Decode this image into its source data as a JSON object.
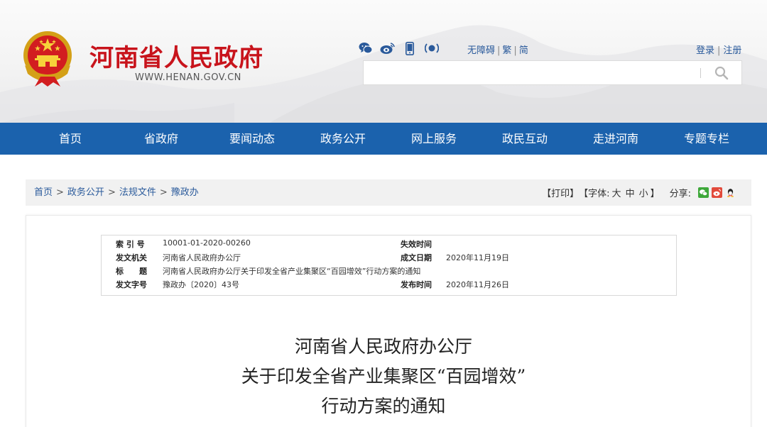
{
  "site": {
    "title": "河南省人民政府",
    "url": "WWW.HENAN.GOV.CN"
  },
  "social_icons": [
    "wechat-icon",
    "weibo-icon",
    "mobile-icon",
    "podcast-icon"
  ],
  "accessibility": {
    "barrier_free": "无障碍",
    "traditional": "繁",
    "simplified": "简",
    "sep": "|"
  },
  "account": {
    "login": "登录",
    "register": "注册",
    "sep": "|"
  },
  "search": {
    "placeholder": ""
  },
  "nav": {
    "items": [
      "首页",
      "省政府",
      "要闻动态",
      "政务公开",
      "网上服务",
      "政民互动",
      "走进河南",
      "专题专栏"
    ]
  },
  "breadcrumb": {
    "items": [
      "首页",
      "政务公开",
      "法规文件",
      "豫政办"
    ],
    "sep": ">"
  },
  "tools": {
    "print": "打印",
    "font_label": "字体:",
    "font_large": "大",
    "font_medium": "中",
    "font_small": "小",
    "share_label": "分享:",
    "lb": "【",
    "rb": "】"
  },
  "meta": {
    "index_label": "索 引 号",
    "index_value": "10001-01-2020-00260",
    "expire_label": "失效时间",
    "expire_value": "",
    "issuer_label": "发文机关",
    "issuer_value": "河南省人民政府办公厅",
    "date_label": "成文日期",
    "date_value": "2020年11月19日",
    "title_label": "标　　题",
    "title_value": "河南省人民政府办公厅关于印发全省产业集聚区“百园增效”行动方案的通知",
    "docno_label": "发文字号",
    "docno_value": "豫政办〔2020〕43号",
    "publish_label": "发布时间",
    "publish_value": "2020年11月26日"
  },
  "document": {
    "title_line1": "河南省人民政府办公厅",
    "title_line2": "关于印发全省产业集聚区“百园增效”",
    "title_line3": "行动方案的通知"
  },
  "colors": {
    "brand_red": "#c8141c",
    "nav_blue": "#1b62ad",
    "link_blue": "#2a5a9b"
  }
}
